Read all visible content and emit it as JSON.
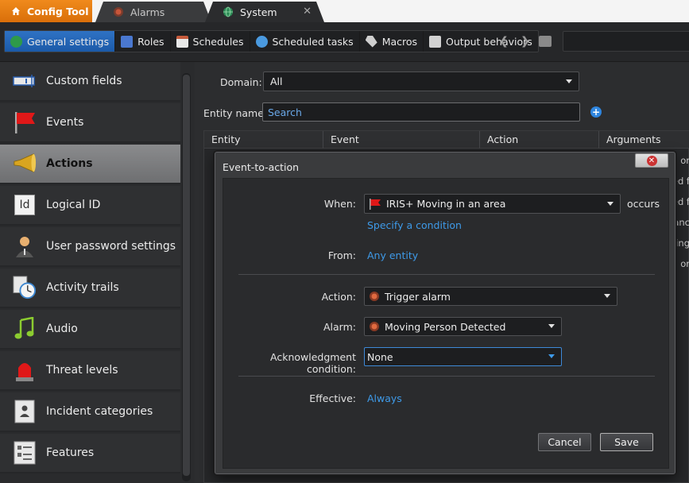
{
  "tabs": {
    "config": "Config Tool",
    "alarms": "Alarms",
    "system": "System",
    "close_glyph": "✕"
  },
  "toolbar": {
    "items": [
      {
        "label": "General settings",
        "icon": "globe-icon",
        "color": "#2e9a4a",
        "active": true
      },
      {
        "label": "Roles",
        "icon": "roles-icon",
        "color": "#4a78d0"
      },
      {
        "label": "Schedules",
        "icon": "calendar-icon",
        "color": "#c65b3c"
      },
      {
        "label": "Scheduled tasks",
        "icon": "scheduled-tasks-icon",
        "color": "#4a9ae0"
      },
      {
        "label": "Macros",
        "icon": "macro-icon",
        "color": "#d2d2d2"
      },
      {
        "label": "Output behaviors",
        "icon": "output-behaviors-icon",
        "color": "#d2d2d2"
      }
    ]
  },
  "sidebar": {
    "items": [
      {
        "label": "Custom fields",
        "name": "custom-fields",
        "icon": "custom-fields-icon"
      },
      {
        "label": "Events",
        "name": "events",
        "icon": "flag-icon"
      },
      {
        "label": "Actions",
        "name": "actions",
        "icon": "megaphone-icon",
        "active": true
      },
      {
        "label": "Logical ID",
        "name": "logical-id",
        "icon": "id-card-icon",
        "icon_text": "Id"
      },
      {
        "label": "User password settings",
        "name": "user-password-settings",
        "icon": "user-icon"
      },
      {
        "label": "Activity trails",
        "name": "activity-trails",
        "icon": "clock-icon"
      },
      {
        "label": "Audio",
        "name": "audio",
        "icon": "music-note-icon"
      },
      {
        "label": "Threat levels",
        "name": "threat-levels",
        "icon": "siren-icon"
      },
      {
        "label": "Incident categories",
        "name": "incident-categories",
        "icon": "incident-categories-icon"
      },
      {
        "label": "Features",
        "name": "features",
        "icon": "features-icon"
      }
    ]
  },
  "main": {
    "domain_label": "Domain:",
    "domain_value": "All",
    "entity_label": "Entity name:",
    "entity_placeholder": "Search",
    "columns": [
      "Entity",
      "Event",
      "Action",
      "Arguments"
    ],
    "peek": [
      "e or",
      "ed f",
      "ed f",
      "anc",
      "ding",
      "n or"
    ]
  },
  "dialog": {
    "title": "Event-to-action",
    "when_label": "When:",
    "when_value": "IRIS+ Moving in an area",
    "occurs": "occurs",
    "specify_condition": "Specify a condition",
    "from_label": "From:",
    "from_value": "Any entity",
    "action_label": "Action:",
    "action_value": "Trigger alarm",
    "alarm_label": "Alarm:",
    "alarm_value": "Moving Person Detected",
    "ack_label": "Acknowledgment condition:",
    "ack_value": "None",
    "effective_label": "Effective:",
    "effective_value": "Always",
    "cancel": "Cancel",
    "save": "Save"
  }
}
